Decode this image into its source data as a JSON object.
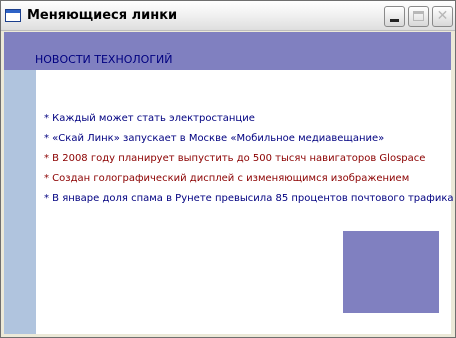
{
  "window": {
    "title": "Меняющиеся линки",
    "buttons": {
      "minimize_icon": "minimize-icon",
      "maximize_icon": "maximize-icon",
      "close_icon": "close-icon",
      "close_glyph": "✕"
    }
  },
  "section": {
    "title": "НОВОСТИ ТЕХНОЛОГИЙ"
  },
  "news": [
    {
      "text": "* Каждый может стать электростанцие",
      "color": "#000080"
    },
    {
      "text": "* «Скай Линк» запускает в Москве «Мобильное медиавещание»",
      "color": "#000080"
    },
    {
      "text": "* В 2008 году планирует выпустить до 500 тысяч навигаторов Glospace",
      "color": "#8b0000"
    },
    {
      "text": "* Создан голографический дисплей с изменяющимся изображением",
      "color": "#8b0000"
    },
    {
      "text": "* В январе доля спама в Рунете превысила 85 процентов почтового трафика",
      "color": "#000080"
    }
  ],
  "colors": {
    "header_band": "#8080c0",
    "left_band": "#b0c4de",
    "link_blue": "#000080",
    "link_red": "#8b0000"
  }
}
